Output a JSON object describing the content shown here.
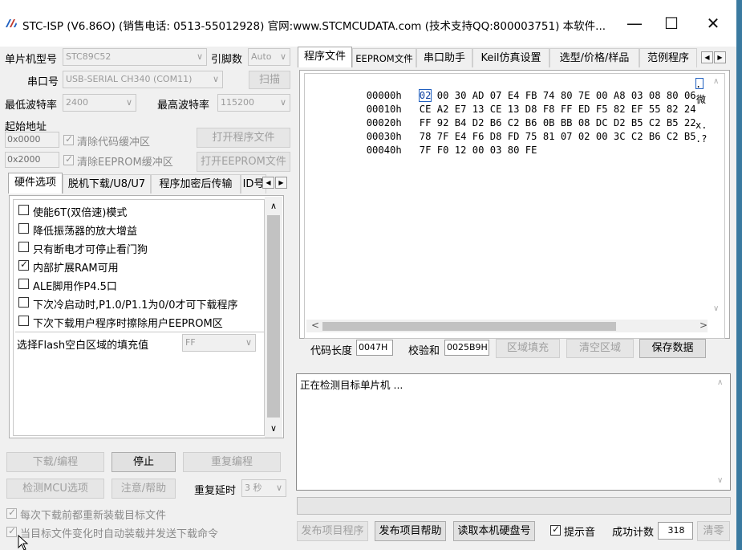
{
  "window": {
    "title": "STC-ISP (V6.86O) (销售电话: 0513-55012928) 官网:www.STCMCUDATA.com  (技术支持QQ:800003751) 本软件...",
    "min_glyph": "—",
    "max_glyph": "☐",
    "close_glyph": "✕"
  },
  "left": {
    "mcu_type_label": "单片机型号",
    "mcu_type_value": "STC89C52",
    "pins_label": "引脚数",
    "pins_value": "Auto",
    "port_label": "串口号",
    "port_value": "USB-SERIAL CH340 (COM11)",
    "scan_button": "扫描",
    "min_baud_label": "最低波特率",
    "min_baud_value": "2400",
    "max_baud_label": "最高波特率",
    "max_baud_value": "115200",
    "start_addr_label": "起始地址",
    "code_addr": "0x0000",
    "clear_code_buffer": "清除代码缓冲区",
    "open_program_button": "打开程序文件",
    "eeprom_addr": "0x2000",
    "clear_eeprom_buffer": "清除EEPROM缓冲区",
    "open_eeprom_button": "打开EEPROM文件",
    "tabs": [
      "硬件选项",
      "脱机下载/U8/U7",
      "程序加密后传输",
      "ID号"
    ],
    "options": [
      {
        "label": "使能6T(双倍速)模式",
        "checked": false
      },
      {
        "label": "降低振荡器的放大增益",
        "checked": false
      },
      {
        "label": "只有断电才可停止看门狗",
        "checked": false
      },
      {
        "label": "内部扩展RAM可用",
        "checked": true
      },
      {
        "label": "ALE脚用作P4.5口",
        "checked": false
      },
      {
        "label": "下次冷启动时,P1.0/P1.1为0/0才可下载程序",
        "checked": false
      },
      {
        "label": "下次下载用户程序时擦除用户EEPROM区",
        "checked": false
      }
    ],
    "flash_fill_label": "选择Flash空白区域的填充值",
    "flash_fill_value": "FF",
    "download_button": "下载/编程",
    "stop_button": "停止",
    "reprogram_button": "重复编程",
    "detect_mcu_button": "检测MCU选项",
    "help_button": "注意/帮助",
    "repeat_delay_label": "重复延时",
    "repeat_delay_value": "3 秒",
    "reload_before_download": "每次下载前都重新装载目标文件",
    "auto_reload_on_change": "当目标文件变化时自动装载并发送下载命令"
  },
  "right": {
    "tabs": [
      "程序文件",
      "EEPROM文件",
      "串口助手",
      "Keil仿真设置",
      "选型/价格/样品",
      "范例程序"
    ],
    "hex_rows": [
      {
        "addr": "00000h",
        "bytes": "00 30 AD 07 E4 FB 74 80 7E 00 A8 03 08 80 06",
        "first": "02",
        "ascii": "."
      },
      {
        "addr": "00010h",
        "bytes": "CE A2 E7 13 CE 13 D8 F8 FF ED F5 82 EF 55 82 24",
        "first": "",
        "ascii": "微"
      },
      {
        "addr": "00020h",
        "bytes": "FF 92 B4 D2 B6 C2 B6 0B BB 08 DC D2 B5 C2 B5 22",
        "first": "",
        "ascii": ""
      },
      {
        "addr": "00030h",
        "bytes": "78 7F E4 F6 D8 FD 75 81 07 02 00 3C C2 B6 C2 B5",
        "first": "",
        "ascii": "x."
      },
      {
        "addr": "00040h",
        "bytes": "7F F0 12 00 03 80 FE",
        "first": "",
        "ascii": ".?"
      }
    ],
    "code_len_label": "代码长度",
    "code_len_value": "0047H",
    "checksum_label": "校验和",
    "checksum_value": "0025B9H",
    "fill_area_button": "区域填充",
    "clear_area_button": "清空区域",
    "save_data_button": "保存数据",
    "log_text": "正在检测目标单片机 ...",
    "publish_program_button": "发布项目程序",
    "publish_help_button": "发布项目帮助",
    "read_disk_button": "读取本机硬盘号",
    "beep_label": "提示音",
    "success_count_label": "成功计数",
    "success_count_value": "318",
    "clear_count_button": "清零"
  }
}
